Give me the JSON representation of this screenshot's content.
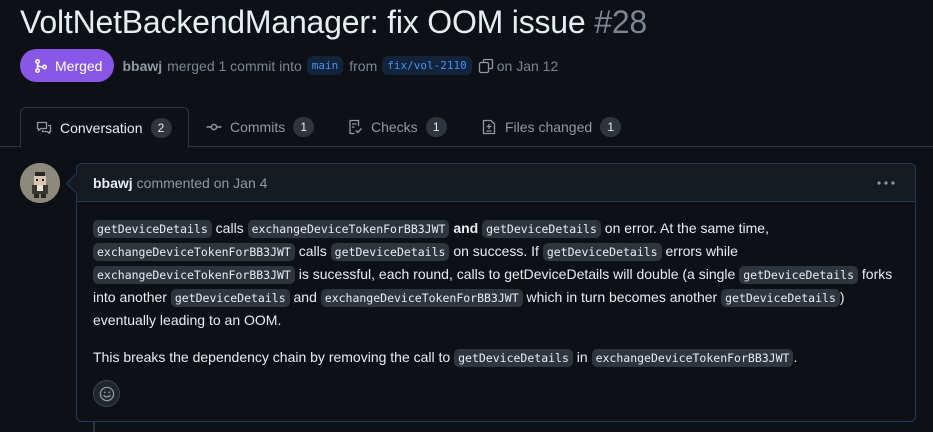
{
  "pr": {
    "title": "VoltNetBackendManager: fix OOM issue",
    "number": "#28",
    "state": "Merged",
    "author": "bbawj",
    "merge_text": "merged 1 commit into",
    "base_branch": "main",
    "from_text": "from",
    "head_branch": "fix/vol-2110",
    "date_text": "on Jan 12"
  },
  "tabs": [
    {
      "label": "Conversation",
      "count": "2"
    },
    {
      "label": "Commits",
      "count": "1"
    },
    {
      "label": "Checks",
      "count": "1"
    },
    {
      "label": "Files changed",
      "count": "1"
    }
  ],
  "comment": {
    "author": "bbawj",
    "meta": "commented on Jan 4",
    "p1": {
      "c1": "getDeviceDetails",
      "t1": " calls ",
      "c2": "exchangeDeviceTokenForBB3JWT",
      "b1": "and",
      "c3": "getDeviceDetails",
      "t2": " on error. At the same time, ",
      "c4": "exchangeDeviceTokenForBB3JWT",
      "t3": " calls ",
      "c5": "getDeviceDetails",
      "t4": " on success. If ",
      "c6": "getDeviceDetails",
      "t5": " errors while ",
      "c7": "exchangeDeviceTokenForBB3JWT",
      "t6": " is sucessful, each round, calls to getDeviceDetails will double (a single ",
      "c8": "getDeviceDetails",
      "t7": " forks into another ",
      "c9": "getDeviceDetails",
      "t8": " and ",
      "c10": "exchangeDeviceTokenForBB3JWT",
      "t9": " which in turn becomes another ",
      "c11": "getDeviceDetails",
      "t10": ") eventually leading to an OOM."
    },
    "p2": {
      "t1": "This breaks the dependency chain by removing the call to ",
      "c1": "getDeviceDetails",
      "t2": " in ",
      "c2": "exchangeDeviceTokenForBB3JWT",
      "t3": "."
    }
  },
  "colors": {
    "merged_badge": "#8957e5",
    "background": "#0d1117",
    "link_branch": "#4493f8"
  },
  "icons": {
    "merge": "git-merge-icon",
    "copy": "copy-icon",
    "conversation": "comment-discussion-icon",
    "commits": "git-commit-icon",
    "checks": "checklist-icon",
    "files": "file-diff-icon",
    "kebab": "kebab-horizontal-icon",
    "reaction": "smiley-icon"
  }
}
